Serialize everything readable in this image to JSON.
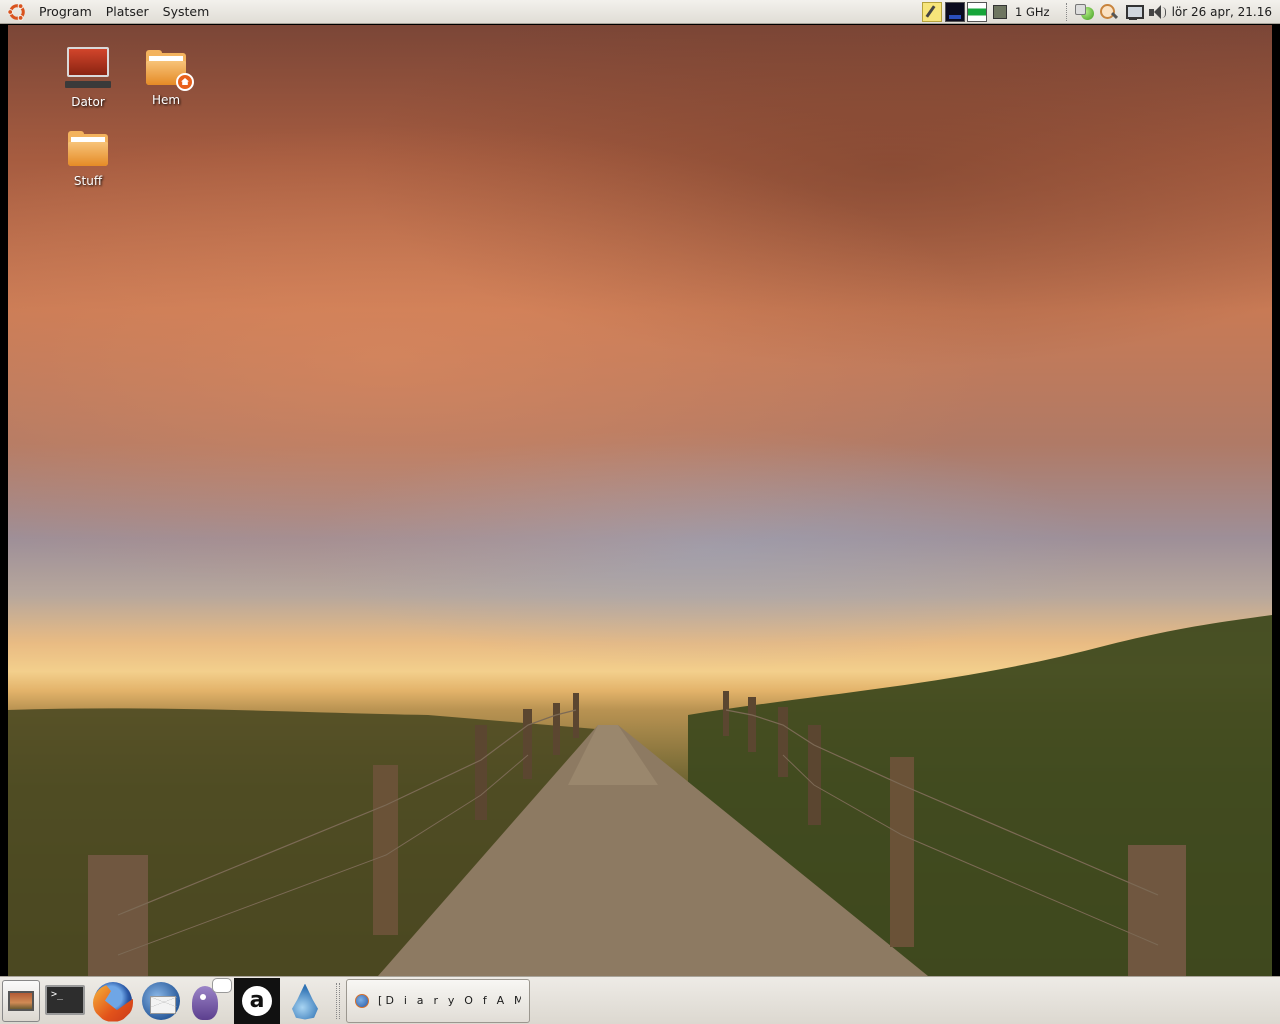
{
  "top_panel": {
    "menus": [
      "Program",
      "Platser",
      "System"
    ],
    "cpu_freq": "1 GHz",
    "clock": "lör 26 apr, 21.16",
    "tray_icons": [
      "notes-icon",
      "system-monitor-icon",
      "network-monitor-icon",
      "cpu-frequency-icon",
      "globe-icon",
      "search-icon",
      "network-icon",
      "volume-icon"
    ]
  },
  "desktop": {
    "icons": [
      {
        "name": "Dator",
        "icon": "computer-icon"
      },
      {
        "name": "Hem",
        "icon": "home-folder-icon"
      },
      {
        "name": "Stuff",
        "icon": "folder-icon"
      }
    ]
  },
  "bottom_panel": {
    "launchers": [
      "show-desktop-icon",
      "terminal-icon",
      "firefox-icon",
      "thunderbird-icon",
      "pidgin-icon",
      "anjuta-icon",
      "drop-icon"
    ],
    "task": {
      "label": "[D i a r y O f A M a d m ..."
    }
  },
  "colors": {
    "panel": "#e6e3dd",
    "ubuntu_orange": "#e8601c",
    "folder": "#f3b35e"
  }
}
